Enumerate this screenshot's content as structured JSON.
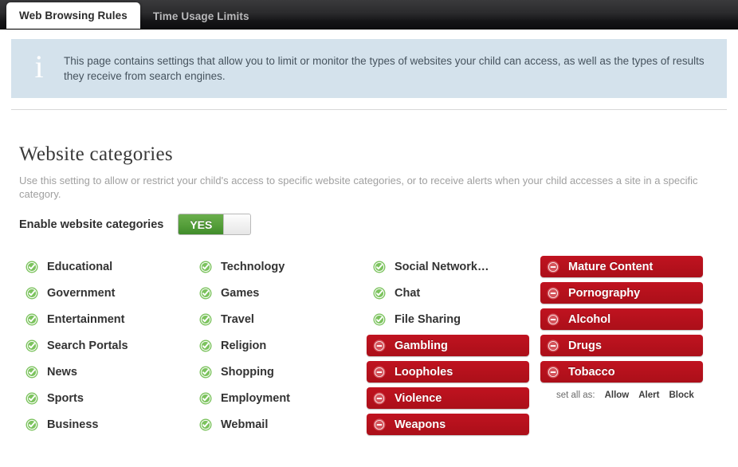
{
  "tabs": [
    {
      "label": "Web Browsing Rules",
      "active": true
    },
    {
      "label": "Time Usage Limits",
      "active": false
    }
  ],
  "banner": {
    "icon": "info-icon",
    "text": "This page contains settings that allow you to limit or monitor the types of websites your child can access, as well as the types of results they receive from search engines."
  },
  "section": {
    "title": "Website categories",
    "description": "Use this setting to allow or restrict your child's access to specific website categories, or to receive alerts when your child accesses a site in a specific category.",
    "toggle": {
      "label": "Enable website categories",
      "value": "YES"
    }
  },
  "colors": {
    "allow_green": "#5cb246",
    "block_red": "#b8111b",
    "banner_blue": "#d4e2ec",
    "tabbar_dark": "#1a1a1c"
  },
  "columns": [
    {
      "items": [
        {
          "label": "Educational",
          "state": "allow",
          "icon": "check-circle-icon"
        },
        {
          "label": "Government",
          "state": "allow",
          "icon": "check-circle-icon"
        },
        {
          "label": "Entertainment",
          "state": "allow",
          "icon": "check-circle-icon"
        },
        {
          "label": "Search Portals",
          "state": "allow",
          "icon": "check-circle-icon"
        },
        {
          "label": "News",
          "state": "allow",
          "icon": "check-circle-icon"
        },
        {
          "label": "Sports",
          "state": "allow",
          "icon": "check-circle-icon"
        },
        {
          "label": "Business",
          "state": "allow",
          "icon": "check-circle-icon"
        }
      ]
    },
    {
      "items": [
        {
          "label": "Technology",
          "state": "allow",
          "icon": "check-circle-icon"
        },
        {
          "label": "Games",
          "state": "allow",
          "icon": "check-circle-icon"
        },
        {
          "label": "Travel",
          "state": "allow",
          "icon": "check-circle-icon"
        },
        {
          "label": "Religion",
          "state": "allow",
          "icon": "check-circle-icon"
        },
        {
          "label": "Shopping",
          "state": "allow",
          "icon": "check-circle-icon"
        },
        {
          "label": "Employment",
          "state": "allow",
          "icon": "check-circle-icon"
        },
        {
          "label": "Webmail",
          "state": "allow",
          "icon": "check-circle-icon"
        }
      ]
    },
    {
      "items": [
        {
          "label": "Social Network…",
          "state": "allow",
          "icon": "check-circle-icon"
        },
        {
          "label": "Chat",
          "state": "allow",
          "icon": "check-circle-icon"
        },
        {
          "label": "File Sharing",
          "state": "allow",
          "icon": "check-circle-icon"
        },
        {
          "label": "Gambling",
          "state": "block",
          "icon": "minus-circle-icon"
        },
        {
          "label": "Loopholes",
          "state": "block",
          "icon": "minus-circle-icon"
        },
        {
          "label": "Violence",
          "state": "block",
          "icon": "minus-circle-icon"
        },
        {
          "label": "Weapons",
          "state": "block",
          "icon": "minus-circle-icon"
        }
      ]
    },
    {
      "items": [
        {
          "label": "Mature Content",
          "state": "block",
          "icon": "minus-circle-icon"
        },
        {
          "label": "Pornography",
          "state": "block",
          "icon": "minus-circle-icon"
        },
        {
          "label": "Alcohol",
          "state": "block",
          "icon": "minus-circle-icon"
        },
        {
          "label": "Drugs",
          "state": "block",
          "icon": "minus-circle-icon"
        },
        {
          "label": "Tobacco",
          "state": "block",
          "icon": "minus-circle-icon"
        }
      ],
      "set_all": {
        "label": "set all as:",
        "options": [
          "Allow",
          "Alert",
          "Block"
        ]
      }
    }
  ]
}
